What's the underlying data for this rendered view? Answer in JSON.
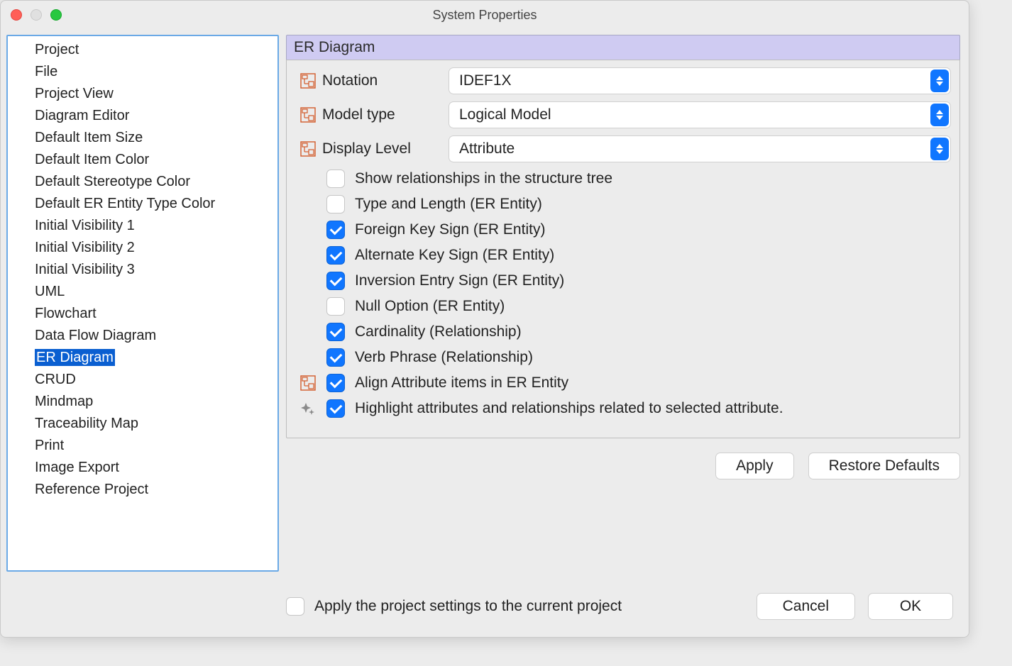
{
  "window": {
    "title": "System Properties"
  },
  "sidebar": {
    "items": [
      "Project",
      "File",
      "Project View",
      "Diagram Editor",
      "Default Item Size",
      "Default Item Color",
      "Default Stereotype Color",
      "Default ER Entity Type Color",
      "Initial Visibility 1",
      "Initial Visibility 2",
      "Initial Visibility 3",
      "UML",
      "Flowchart",
      "Data Flow Diagram",
      "ER Diagram",
      "CRUD",
      "Mindmap",
      "Traceability Map",
      "Print",
      "Image Export",
      "Reference Project"
    ],
    "selected_index": 14
  },
  "panel": {
    "title": "ER Diagram",
    "fields": {
      "notation": {
        "label": "Notation",
        "value": "IDEF1X"
      },
      "model_type": {
        "label": "Model type",
        "value": "Logical Model"
      },
      "display_level": {
        "label": "Display Level",
        "value": "Attribute"
      }
    },
    "checks": [
      {
        "label": "Show relationships in the structure tree",
        "checked": false,
        "prefix": "none"
      },
      {
        "label": "Type and Length (ER Entity)",
        "checked": false,
        "prefix": "none"
      },
      {
        "label": "Foreign Key Sign (ER Entity)",
        "checked": true,
        "prefix": "none"
      },
      {
        "label": "Alternate Key Sign (ER Entity)",
        "checked": true,
        "prefix": "none"
      },
      {
        "label": "Inversion Entry Sign (ER Entity)",
        "checked": true,
        "prefix": "none"
      },
      {
        "label": "Null Option (ER Entity)",
        "checked": false,
        "prefix": "none"
      },
      {
        "label": "Cardinality (Relationship)",
        "checked": true,
        "prefix": "none"
      },
      {
        "label": "Verb Phrase (Relationship)",
        "checked": true,
        "prefix": "none"
      },
      {
        "label": "Align Attribute items in ER Entity",
        "checked": true,
        "prefix": "er"
      },
      {
        "label": "Highlight attributes and relationships related to selected attribute.",
        "checked": true,
        "prefix": "sparkle"
      }
    ],
    "buttons": {
      "apply": "Apply",
      "restore": "Restore Defaults"
    }
  },
  "footer": {
    "apply_check": {
      "label": "Apply the project settings to the current project",
      "checked": false
    },
    "cancel": "Cancel",
    "ok": "OK"
  }
}
